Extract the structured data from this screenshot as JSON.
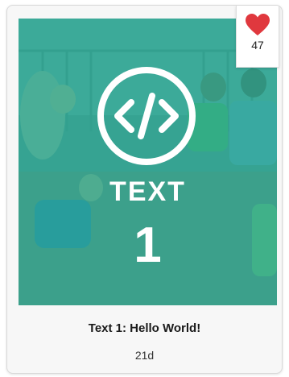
{
  "card": {
    "thumbnail": {
      "type_label": "TEXT",
      "number_label": "1",
      "icon": "code-brackets-icon",
      "overlay_color": "#26aa96"
    },
    "likes": {
      "icon": "heart-icon",
      "count": "47",
      "heart_color": "#e0383e"
    },
    "title": "Text 1: Hello World!",
    "age": "21d"
  }
}
